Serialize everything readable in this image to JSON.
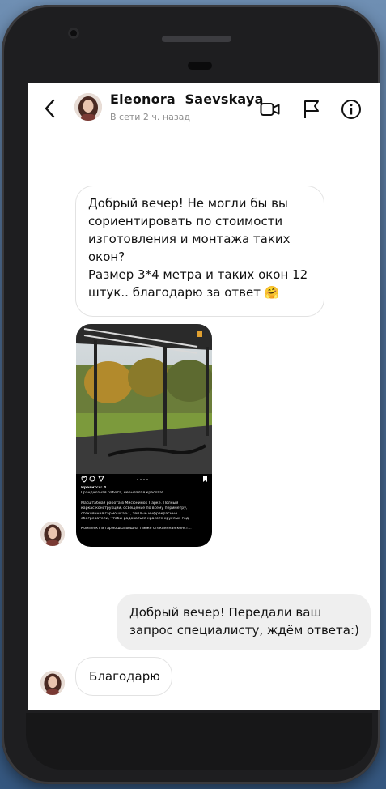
{
  "header": {
    "contact_name": "Eleonora  Saevskaya",
    "status": "В сети 2 ч. назад"
  },
  "icons": {
    "back": "chevron-left-icon",
    "video": "video-camera-icon",
    "flag": "flag-icon",
    "info": "info-icon"
  },
  "messages": [
    {
      "direction": "incoming",
      "lines": [
        "Добрый вечер! Не могли бы вы",
        "сориентировать по стоимости",
        "изготовления и монтажа таких",
        "окон?",
        "Размер 3*4 метра и таких окон 12",
        "штук.. благодарю за ответ 🤗"
      ]
    },
    {
      "direction": "incoming",
      "type": "shared_post",
      "post": {
        "likes": "Нравится: 4",
        "caption_lines": [
          "Грандиозная работа, небывалая красота!",
          "",
          "Масштабная работа в Мисюнинок Парке. Полный",
          "каркас конструкции, освещение по всему периметру,",
          "стеклянная гармошка F1, теплые инфракрасные",
          "обогреватели, чтобы радоваться красоте круглый год.",
          "",
          "Комплект и гармошка вошла также стеклянная конст..."
        ]
      }
    },
    {
      "direction": "outgoing",
      "lines": [
        "Добрый вечер! Передали ваш",
        "запрос специалисту, ждём ответа:)"
      ]
    },
    {
      "direction": "incoming",
      "lines": [
        "Благодарю"
      ]
    }
  ],
  "colors": {
    "background": "#4f6f97",
    "phone_body": "#1e1e20",
    "incoming_border": "#e2e2e2",
    "outgoing_bubble": "#efefef"
  }
}
